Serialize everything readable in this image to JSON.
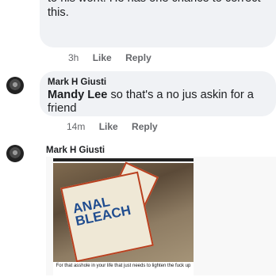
{
  "comments": [
    {
      "text": "If this guy doesn’t delete his, I will report it to his work. He has one chance to correct this.",
      "time": "3h",
      "like_label": "Like",
      "reply_label": "Reply"
    },
    {
      "author": "Mark H Giusti",
      "mention": "Mandy Lee",
      "text": " so that's a no jus askin for a friend",
      "time": "14m",
      "like_label": "Like",
      "reply_label": "Reply"
    },
    {
      "author": "Mark H Giusti",
      "image": {
        "box_text_1": "ANAL",
        "box_text_2": "BLEACH",
        "caption": "For that asshole in your life that just needs to lighten the fuck up"
      }
    }
  ]
}
